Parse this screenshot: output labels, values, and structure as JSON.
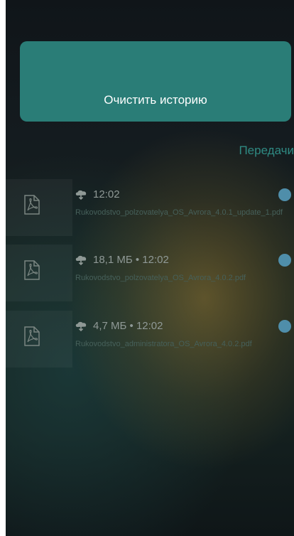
{
  "actions": {
    "clear_history_label": "Очистить историю"
  },
  "section": {
    "title": "Передачи"
  },
  "transfers": [
    {
      "status": "12:02",
      "file_name": "Rukovodstvo_polzovatelya_OS_Avrora_4.0.1_update_1.pdf",
      "icon": "pdf-file-icon",
      "direction_icon": "download-cloud-icon"
    },
    {
      "status": "18,1 МБ • 12:02",
      "file_name": "Rukovodstvo_polzovatelya_OS_Avrora_4.0.2.pdf",
      "icon": "pdf-file-icon",
      "direction_icon": "download-cloud-icon"
    },
    {
      "status": "4,7 МБ • 12:02",
      "file_name": "Rukovodstvo_administratora_OS_Avrora_4.0.2.pdf",
      "icon": "pdf-file-icon",
      "direction_icon": "download-cloud-icon"
    }
  ],
  "colors": {
    "accent": "#2a7d77",
    "section_title": "#2f8a83",
    "status_dot": "#4f8eaa"
  }
}
